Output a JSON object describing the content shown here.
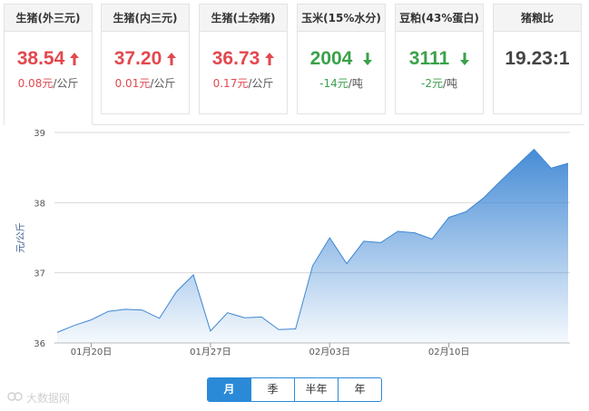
{
  "tabs": [
    {
      "label": "生猪(外三元)",
      "price": "38.54",
      "direction": "up",
      "change": "0.08元",
      "unit": "/公斤"
    },
    {
      "label": "生猪(内三元)",
      "price": "37.20",
      "direction": "up",
      "change": "0.01元",
      "unit": "/公斤"
    },
    {
      "label": "生猪(土杂猪)",
      "price": "36.73",
      "direction": "up",
      "change": "0.17元",
      "unit": "/公斤"
    },
    {
      "label": "玉米(15%水分)",
      "price": "2004",
      "direction": "down",
      "change": "-14元",
      "unit": "/吨"
    },
    {
      "label": "豆粕(43%蛋白)",
      "price": "3111",
      "direction": "down",
      "change": "-2元",
      "unit": "/吨"
    },
    {
      "label": "猪粮比",
      "price": "19.23:1",
      "direction": "none",
      "change": "",
      "unit": ""
    }
  ],
  "colors": {
    "up": "#e2484f",
    "down": "#3aa14a",
    "accent": "#2a8ad8",
    "line": "#3d86d4"
  },
  "periods": {
    "items": [
      "月",
      "季",
      "半年",
      "年"
    ],
    "selected": "月"
  },
  "watermark": "大数据网",
  "chart_data": {
    "type": "area",
    "ylabel": "元/公斤",
    "xlabel": "",
    "ylim": [
      36,
      39
    ],
    "yticks": [
      36,
      37,
      38,
      39
    ],
    "xtick_labels": [
      "01月20日",
      "01月27日",
      "02月03日",
      "02月10日"
    ],
    "grid": true,
    "series": [
      {
        "values": [
          36.15,
          36.25,
          36.33,
          36.45,
          36.48,
          36.47,
          36.35,
          36.73,
          36.97,
          36.17,
          36.43,
          36.36,
          36.37,
          36.19,
          36.2,
          37.1,
          37.5,
          37.13,
          37.45,
          37.43,
          37.59,
          37.57,
          37.48,
          37.79,
          37.87,
          38.06,
          38.3,
          38.53,
          38.76,
          38.49,
          38.56
        ]
      }
    ]
  }
}
